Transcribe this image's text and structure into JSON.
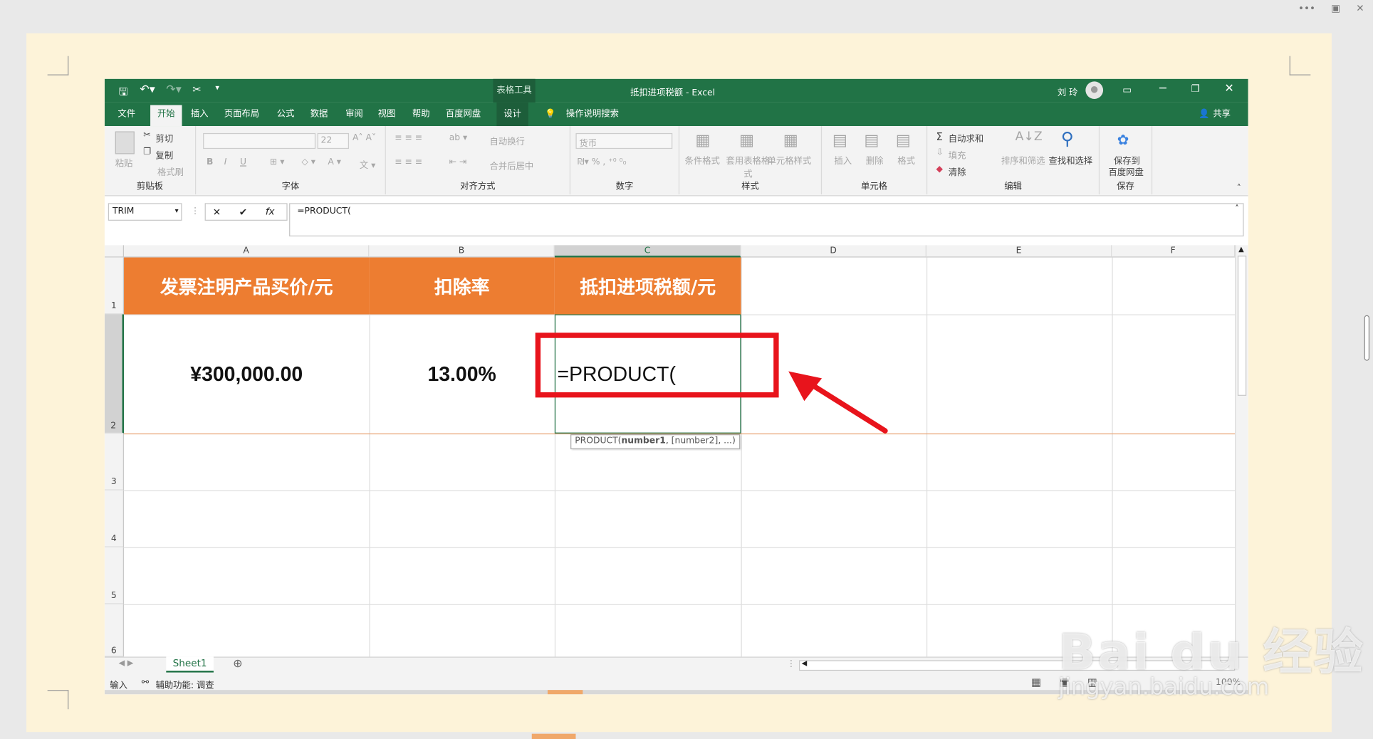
{
  "window": {
    "title": "抵扣进项税额 - Excel",
    "table_tools": "表格工具",
    "user": "刘 玲",
    "share": "共享"
  },
  "tabs": [
    "文件",
    "开始",
    "插入",
    "页面布局",
    "公式",
    "数据",
    "审阅",
    "视图",
    "帮助",
    "百度网盘",
    "设计"
  ],
  "tell_me": "操作说明搜索",
  "ribbon": {
    "clipboard": {
      "paste": "粘贴",
      "cut": "剪切",
      "copy": "复制",
      "format_painter": "格式刷",
      "label": "剪贴板"
    },
    "font": {
      "size": "22",
      "label": "字体"
    },
    "alignment": {
      "wrap": "自动换行",
      "merge": "合并后居中",
      "label": "对齐方式"
    },
    "number": {
      "format": "货币",
      "label": "数字"
    },
    "styles": {
      "conditional": "条件格式",
      "table": "套用表格格式",
      "cell_styles": "单元格样式",
      "label": "样式"
    },
    "cells": {
      "insert": "插入",
      "delete": "删除",
      "format": "格式",
      "label": "单元格"
    },
    "editing": {
      "autosum": "自动求和",
      "fill": "填充",
      "clear": "清除",
      "sort": "排序和筛选",
      "find": "查找和选择",
      "label": "编辑"
    },
    "save": {
      "save_to": "保存到",
      "baidu": "百度网盘",
      "label": "保存"
    }
  },
  "formula_bar": {
    "name_box": "TRIM",
    "fx": "fx",
    "formula": "=PRODUCT("
  },
  "columns": [
    "A",
    "B",
    "C",
    "D",
    "E",
    "F"
  ],
  "rows": [
    "1",
    "2",
    "3",
    "4",
    "5",
    "6"
  ],
  "header_row": [
    "发票注明产品买价/元",
    "扣除率",
    "抵扣进项税额/元"
  ],
  "data_row": [
    "¥300,000.00",
    "13.00%",
    "=PRODUCT("
  ],
  "tooltip": {
    "fn": "PRODUCT(",
    "arg1": "number1",
    ",rest": ", [number2], ...)"
  },
  "sheet_tab": "Sheet1",
  "status": {
    "mode": "输入",
    "accessibility": "辅助功能: 调查",
    "zoom": "100%"
  },
  "watermark": {
    "logo": "Bai du 经验",
    "url": "jingyan.baidu.com"
  },
  "colors": {
    "excel_green": "#217346",
    "header_orange": "#ed7d31",
    "highlight_red": "#e8141c",
    "page_bg": "#fdf3d9"
  }
}
